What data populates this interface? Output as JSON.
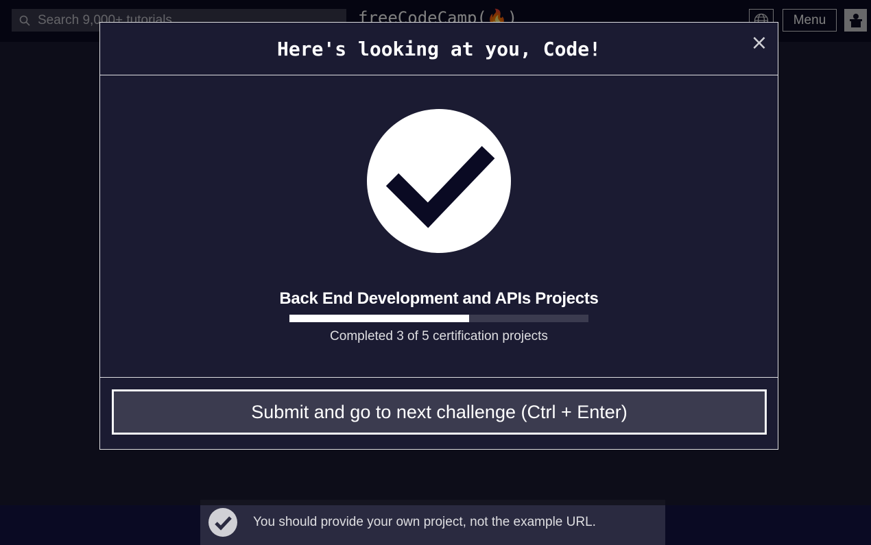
{
  "navbar": {
    "search_placeholder": "Search 9,000+ tutorials",
    "brand": "freeCodeCamp(🔥)",
    "menu_label": "Menu",
    "icons": [
      "search-icon",
      "globe-icon",
      "avatar-icon"
    ]
  },
  "background": {
    "test_text": "You should provide your own project, not the example URL."
  },
  "modal": {
    "title": "Here's looking at you, Code!",
    "close_label": "×",
    "certification": "Back End Development and APIs Projects",
    "progress": {
      "completed": 3,
      "total": 5,
      "fraction": 0.6
    },
    "progress_text": "Completed 3 of 5 certification projects",
    "submit_label": "Submit and go to next challenge (Ctrl + Enter)"
  },
  "colors": {
    "background": "#0a0a23",
    "surface": "#1b1b32",
    "button": "#3b3b4f",
    "text": "#ffffff",
    "muted": "#dfdfe2"
  }
}
